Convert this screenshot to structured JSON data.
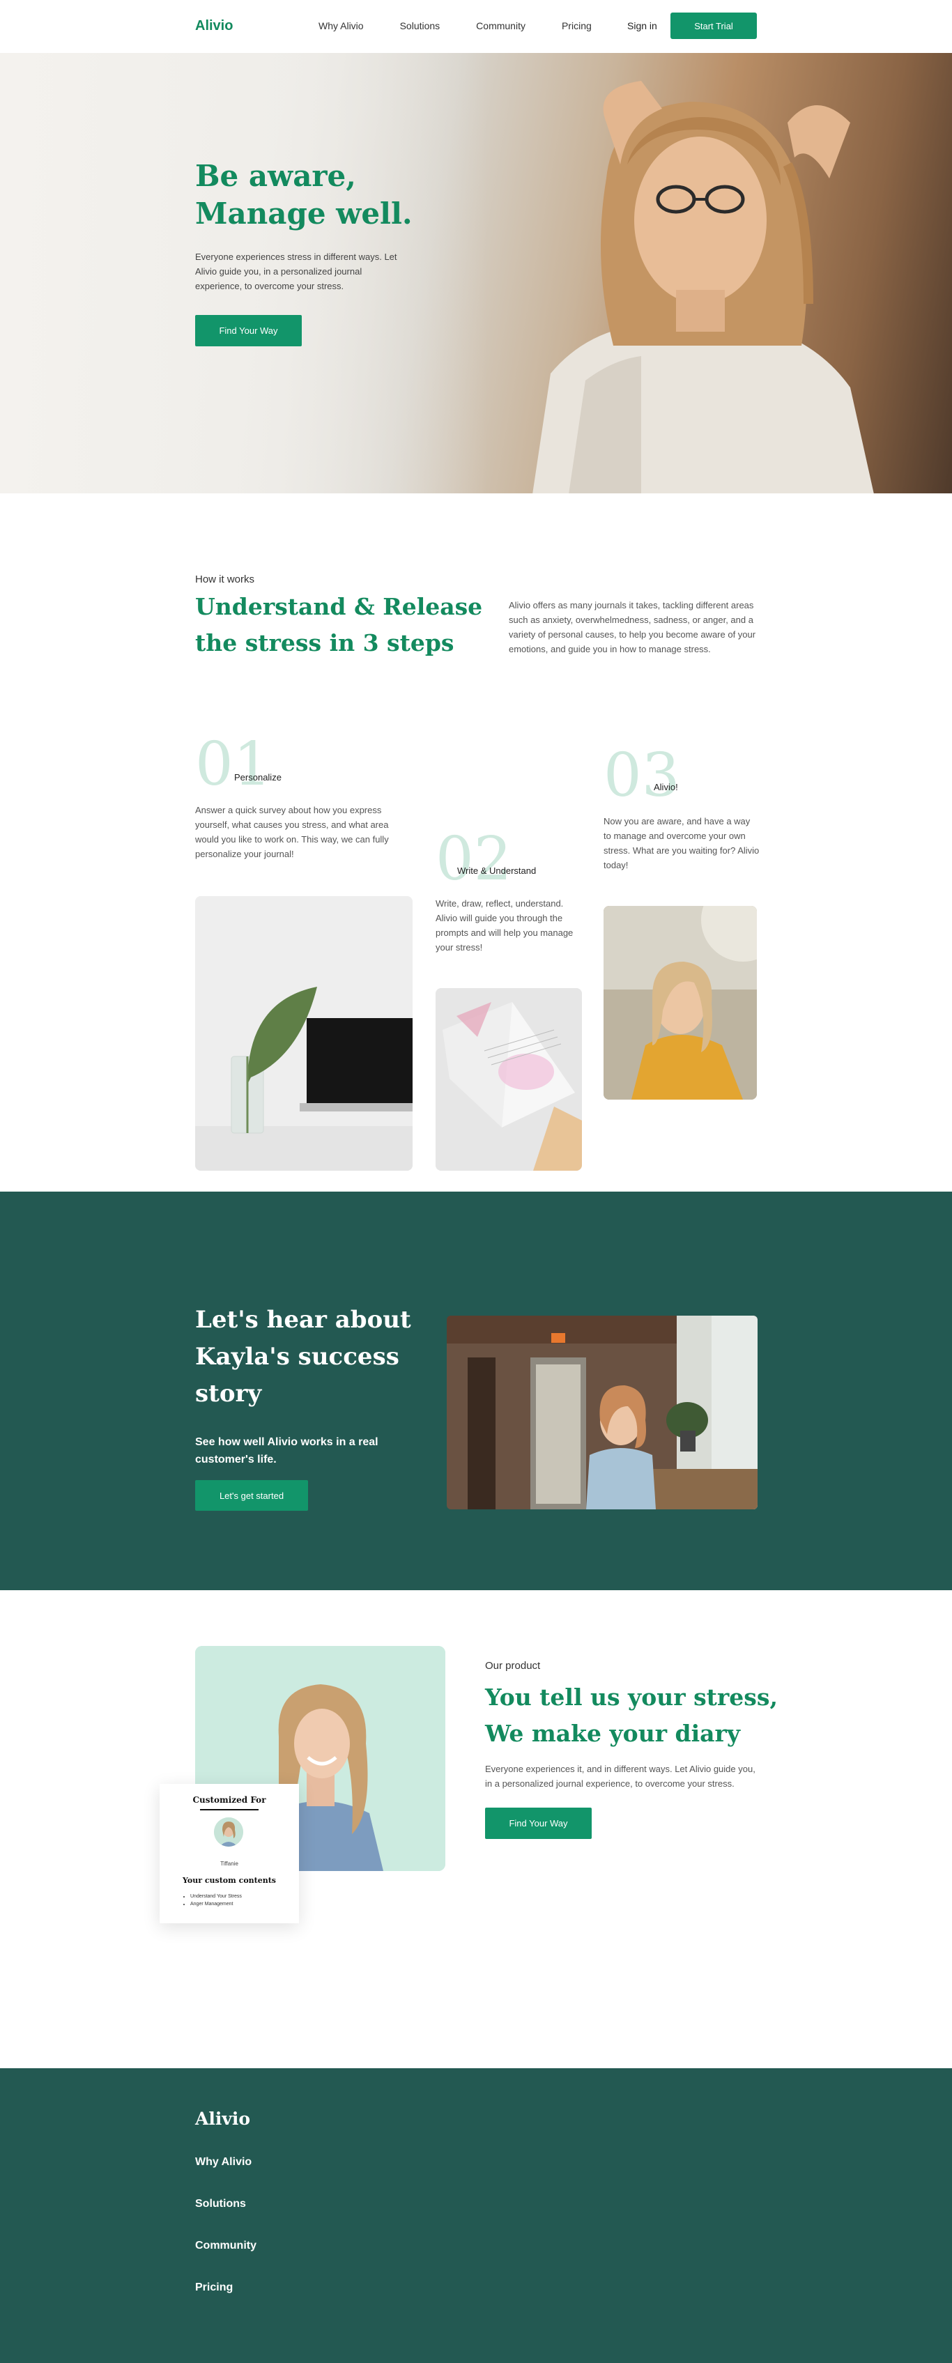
{
  "nav": {
    "logo": "Alivio",
    "links": [
      "Why Alivio",
      "Solutions",
      "Community",
      "Pricing"
    ],
    "signin": "Sign in",
    "cta": "Start Trial"
  },
  "hero": {
    "title_line1": "Be aware,",
    "title_line2": "Manage well.",
    "description": "Everyone experiences stress in different ways. Let Alivio guide you, in a personalized journal experience, to overcome your stress.",
    "button": "Find Your Way"
  },
  "how_it_works": {
    "label": "How it works",
    "title": "Understand & Release the stress in 3 steps",
    "description": "Alivio offers as many journals it takes, tackling different areas such as anxiety, overwhelmedness, sadness, or anger, and a variety of personal causes, to help you become aware of your emotions, and guide you in how to manage stress.",
    "steps": [
      {
        "num": "01",
        "label": "Personalize",
        "desc": "Answer a quick survey about how you express yourself, what causes you stress, and what area would you like to work on. This way, we can fully personalize your journal!"
      },
      {
        "num": "02",
        "label": "Write & Understand",
        "desc": "Write, draw, reflect, understand. Alivio will guide you through the prompts and will help you manage your stress!"
      },
      {
        "num": "03",
        "label": "Alivio!",
        "desc": "Now you are aware, and have a way to manage and overcome your own stress. What are you waiting for? Alivio today!"
      }
    ]
  },
  "story": {
    "title": "Let's hear about Kayla's success story",
    "subtitle": "See how well Alivio works in a real customer's life.",
    "button": "Let's get started"
  },
  "product": {
    "card_title": "Customized For",
    "card_name": "Tiffanie",
    "card_subtitle": "Your custom contents",
    "card_items": [
      "Understand Your Stress",
      "Anger Management"
    ],
    "label": "Our product",
    "title": "You tell us your stress, We make your diary",
    "description": "Everyone experiences it, and in different ways. Let Alivio guide you, in a personalized journal experience, to overcome your stress.",
    "button": "Find Your Way"
  },
  "footer": {
    "logo": "Alivio",
    "links": [
      "Why Alivio",
      "Solutions",
      "Community",
      "Pricing"
    ]
  },
  "colors": {
    "brand_green": "#138a5e",
    "button_green": "#12956a",
    "dark_teal": "#235952",
    "mint": "#ccebe0"
  }
}
